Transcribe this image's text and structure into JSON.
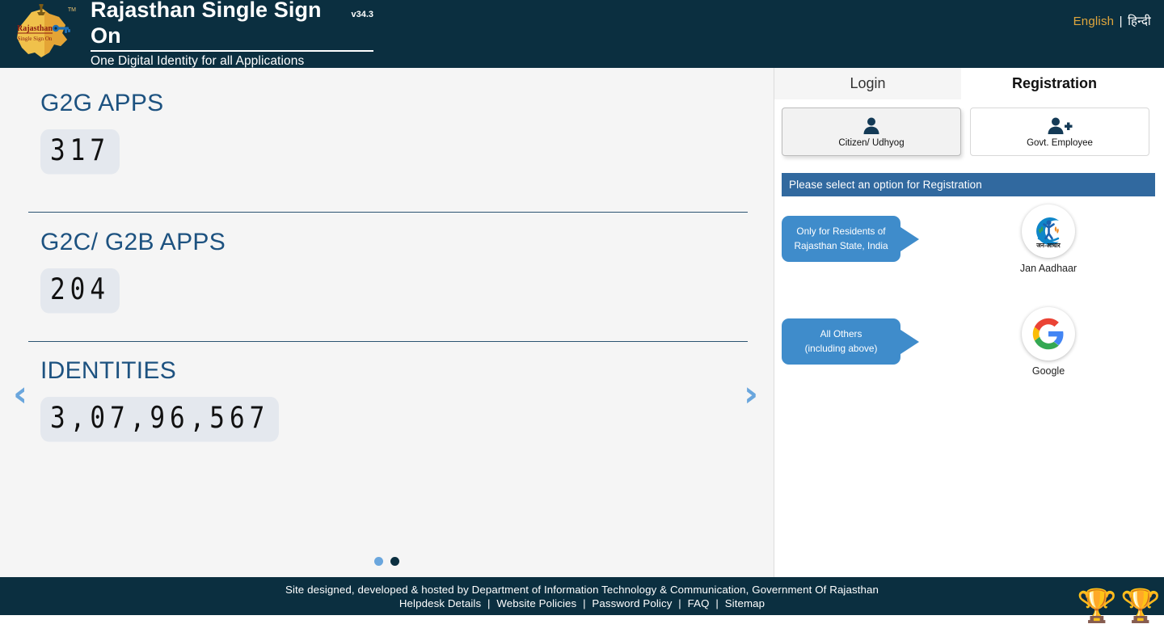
{
  "header": {
    "logo_alt": "rajasthan-sso-logo",
    "title": "Rajasthan Single Sign On",
    "version": "v34.3",
    "tagline": "One Digital Identity for all Applications",
    "trademark": "TM",
    "language": {
      "english": "English",
      "separator": "|",
      "hindi": "हिन्दी"
    }
  },
  "stats": {
    "blocks": [
      {
        "title": "G2G APPS",
        "value": "317"
      },
      {
        "title": "G2C/ G2B APPS",
        "value": "204"
      },
      {
        "title": "IDENTITIES",
        "value": "3,07,96,567"
      }
    ],
    "carousel": {
      "prev": "‹",
      "next": "›",
      "dots": 2,
      "active_dot": 2
    }
  },
  "auth": {
    "tabs": [
      {
        "label": "Login",
        "active": false
      },
      {
        "label": "Registration",
        "active": true
      }
    ],
    "roles": [
      {
        "label": "Citizen/ Udhyog",
        "icon": "person-icon",
        "selected": true
      },
      {
        "label": "Govt. Employee",
        "icon": "person-add-icon",
        "selected": false
      }
    ],
    "notice": "Please select an option for Registration",
    "options": [
      {
        "bubble_lines": [
          "Only for Residents of",
          "Rajasthan State, India"
        ],
        "provider": "Jan Aadhaar",
        "provider_icon": "jan-aadhaar-logo"
      },
      {
        "bubble_lines": [
          "All Others",
          "(including above)"
        ],
        "provider": "Google",
        "provider_icon": "google-logo"
      }
    ]
  },
  "footer": {
    "credit": "Site designed, developed & hosted by Department of Information Technology & Communication, Government Of Rajasthan",
    "links": [
      "Helpdesk Details",
      "Website Policies",
      "Password Policy",
      "FAQ",
      "Sitemap"
    ],
    "separator": "|",
    "awards": [
      "🏆",
      "🏆"
    ]
  },
  "colors": {
    "header_bg": "#0b2f40",
    "accent_blue": "#1d5280",
    "notice_blue": "#31699f",
    "bubble_blue": "#3f8ccb",
    "arrow_blue": "#6aa6dd",
    "lang_active": "#e0a63c"
  }
}
